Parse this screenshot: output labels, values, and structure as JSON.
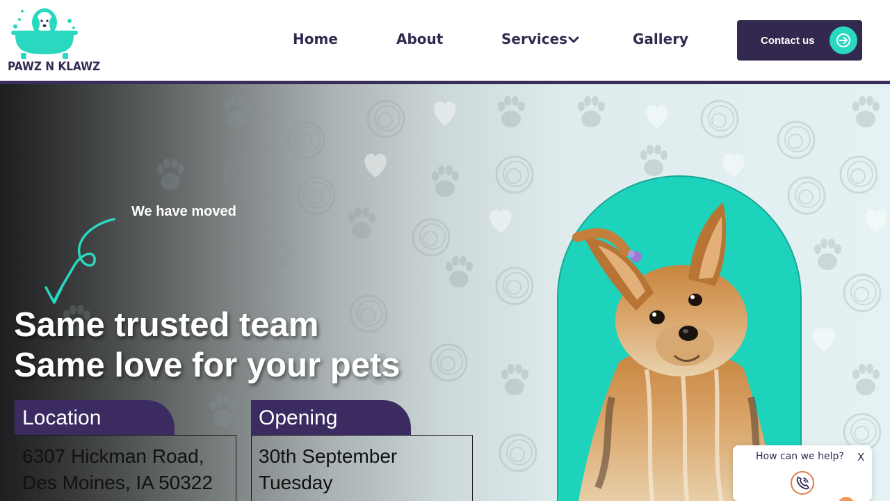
{
  "brand": {
    "name": "PAWZ N KLAWZ",
    "accent": "#2ad8bf",
    "primary": "#33294f"
  },
  "nav": {
    "items": [
      {
        "label": "Home"
      },
      {
        "label": "About"
      },
      {
        "label": "Services"
      },
      {
        "label": "Gallery"
      }
    ],
    "services_icon": "chevron-down-icon",
    "contact_label": "Contact us",
    "contact_icon": "arrow-right-circle-icon"
  },
  "hero": {
    "moved_text": "We have moved",
    "headline_line1": "Same trusted team",
    "headline_line2": "Same love for your pets",
    "location": {
      "title": "Location",
      "line1": "6307 Hickman Road,",
      "line2": "Des Moines, IA 50322"
    },
    "opening": {
      "title": "Opening",
      "line1": "30th September",
      "line2": "Tuesday"
    }
  },
  "chat": {
    "prompt": "How can we help?",
    "close_label": "X",
    "icon": "phone-icon"
  }
}
